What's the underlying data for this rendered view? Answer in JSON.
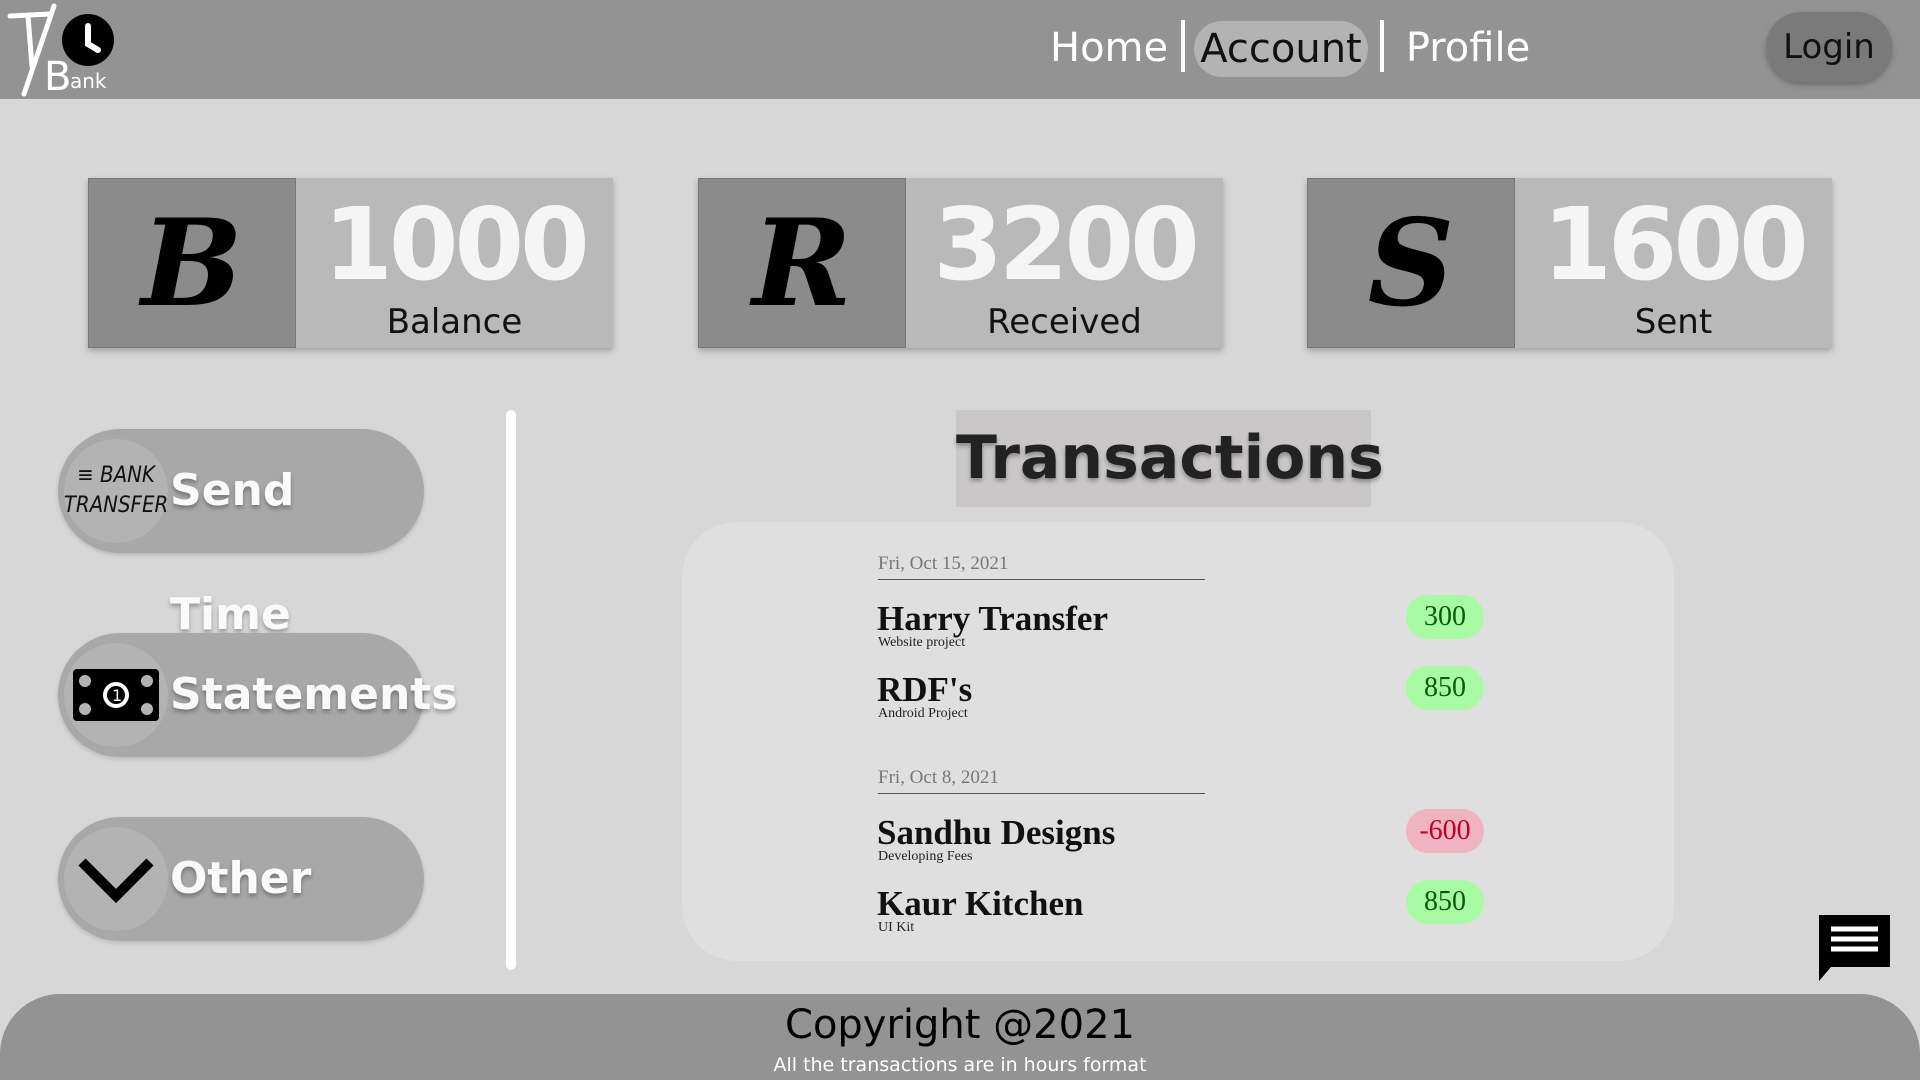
{
  "header": {
    "logo": "T/Bank",
    "nav": [
      "Home",
      "Account",
      "Profile"
    ],
    "active": "Account",
    "login": "Login"
  },
  "cards": [
    {
      "letter": "B",
      "value": "1000",
      "label": "Balance"
    },
    {
      "letter": "R",
      "value": "3200",
      "label": "Received"
    },
    {
      "letter": "S",
      "value": "1600",
      "label": "Sent"
    }
  ],
  "sidebar": [
    {
      "label": "Send Time",
      "icon": "bank-transfer-icon",
      "icon_text": [
        "BANK",
        "TRANSFER"
      ]
    },
    {
      "label": "Statements",
      "icon": "banknote-icon"
    },
    {
      "label": "Other",
      "icon": "chevron-down-icon"
    }
  ],
  "transactions": {
    "title": "Transactions",
    "groups": [
      {
        "date": "Fri, Oct 15, 2021",
        "items": [
          {
            "name": "Harry Transfer",
            "desc": "Website project",
            "amount": "300",
            "type": "credit"
          },
          {
            "name": "RDF's",
            "desc": "Android Project",
            "amount": "850",
            "type": "credit"
          }
        ]
      },
      {
        "date": "Fri, Oct 8, 2021",
        "items": [
          {
            "name": "Sandhu Designs",
            "desc": "Developing Fees",
            "amount": "-600",
            "type": "debit"
          },
          {
            "name": "Kaur Kitchen",
            "desc": "UI Kit",
            "amount": "850",
            "type": "credit"
          }
        ]
      }
    ]
  },
  "footer": {
    "copyright": "Copyright @2021",
    "note": "All the transactions are in hours format"
  },
  "colors": {
    "credit": "#a9fba3",
    "debit": "#f0b3c0",
    "header": "#939393"
  }
}
